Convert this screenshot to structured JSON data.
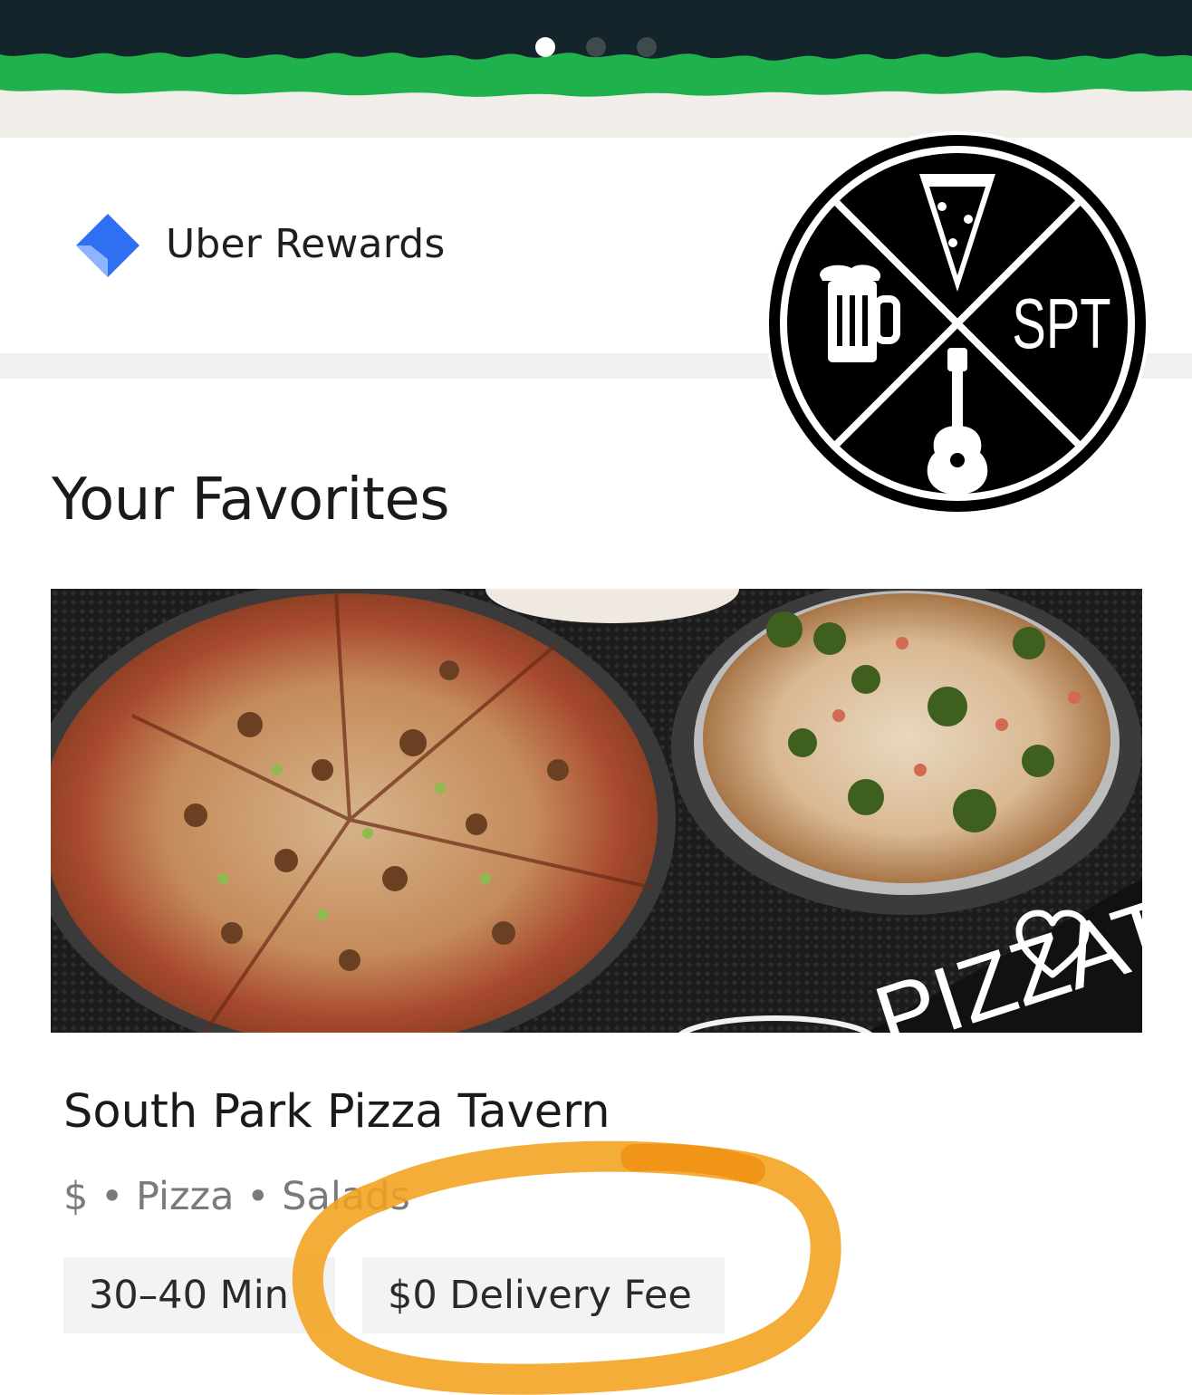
{
  "banner": {
    "carousel_pages": 3,
    "active_page": 1,
    "colors": {
      "dark": "#13242a",
      "green": "#1fb14c",
      "cream": "#f1eeea"
    }
  },
  "rewards": {
    "label": "Uber Rewards",
    "icon": "blue-diamond-icon",
    "icon_color": "#2f6ff2"
  },
  "logo": {
    "text": "SPT",
    "icons": [
      "pizza-slice-icon",
      "beer-mug-icon",
      "guitar-icon"
    ]
  },
  "favorites": {
    "title": "Your Favorites",
    "restaurants": [
      {
        "name": "South Park Pizza Tavern",
        "meta": "$ • Pizza • Salads",
        "eta": "30–40 Min",
        "delivery_fee": "$0 Delivery Fee",
        "favorite_icon": "heart-outline-icon",
        "photo_sign_text": "PIZZATO"
      }
    ]
  },
  "annotation": {
    "shape": "hand-drawn ellipse around delivery fee",
    "color": "#f2a21c"
  }
}
